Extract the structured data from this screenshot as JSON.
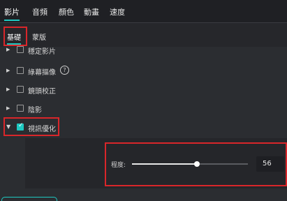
{
  "top_tabs": [
    "影片",
    "音頻",
    "顏色",
    "動畫",
    "速度"
  ],
  "sub_tabs": [
    "基礎",
    "蒙版"
  ],
  "list": {
    "items": [
      {
        "label": "穩定影片",
        "checked": false,
        "expanded": false
      },
      {
        "label": "綠幕摳像",
        "checked": false,
        "expanded": false,
        "help_icon": "?"
      },
      {
        "label": "鏡頭校正",
        "checked": false,
        "expanded": false
      },
      {
        "label": "陰影",
        "checked": false,
        "expanded": false
      },
      {
        "label": "視訊優化",
        "checked": true,
        "expanded": true
      }
    ]
  },
  "enhance_panel": {
    "slider_label": "程度:",
    "value": "56",
    "slider_fraction": 0.56
  },
  "colors": {
    "accent": "#1ec9c2",
    "highlight_box": "#d9262a",
    "background": "#2b2d31"
  }
}
